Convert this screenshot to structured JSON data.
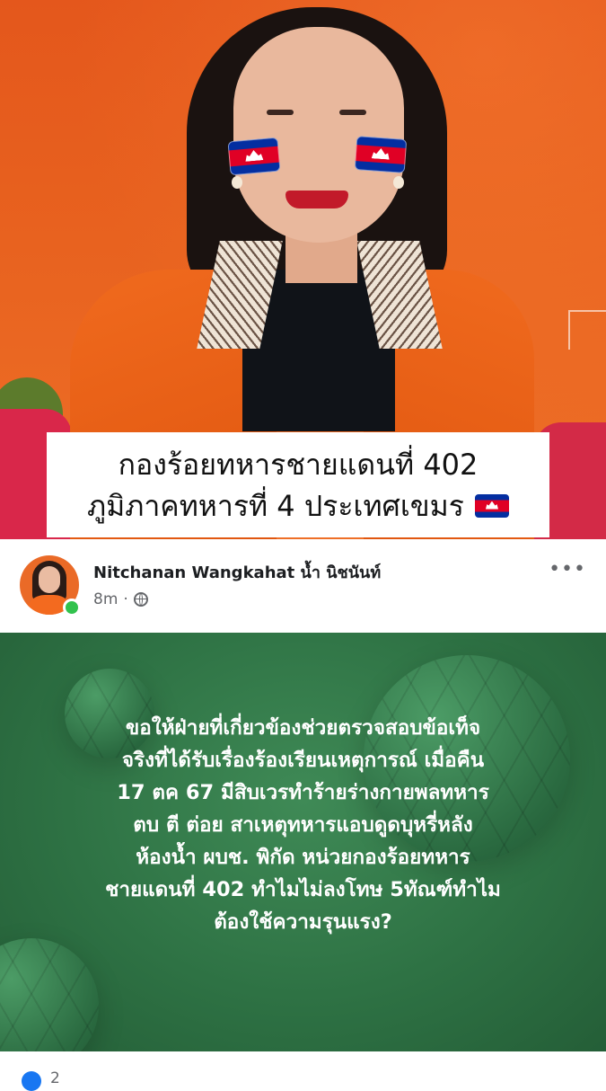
{
  "photo": {
    "caption_line1": "กองร้อยทหารชายแดนที่ 402",
    "caption_line2": "ภูมิภาคทหารที่ 4 ประเทศเขมร",
    "flag_emoji": "cambodia-flag",
    "colors": {
      "background": "#e8621f",
      "jacket": "#f06a1e",
      "flag_blue": "#032ea1",
      "flag_red": "#e00025"
    }
  },
  "post": {
    "author": "Nitchanan Wangkahat น้ำ นิชนันท์",
    "time": "8m",
    "separator": "·",
    "audience_icon": "globe-icon",
    "more_label": "•••",
    "online": true
  },
  "status": {
    "background_color": "#2e7244",
    "lines": [
      "ขอให้ฝ่ายที่เกี่ยวข้องช่วยตรวจสอบข้อเท็จ",
      "จริงที่ได้รับเรื่องร้องเรียนเหตุการณ์ เมื่อคืน",
      "17 ตค 67 มีสิบเวรทำร้ายร่างกายพลทหาร",
      "ตบ ตี ต่อย สาเหตุทหารแอบดูดบุหรี่หลัง",
      "ห้องน้ำ ผบช. พิกัด หน่วยกองร้อยทหาร",
      "ชายแดนที่ 402 ทำไมไม่ลงโทษ 5ทัณฑ์ทำไม",
      "ต้องใช้ความรุนแรง?"
    ]
  },
  "footer": {
    "reaction_icon": "like-icon",
    "reaction_count": "2"
  }
}
